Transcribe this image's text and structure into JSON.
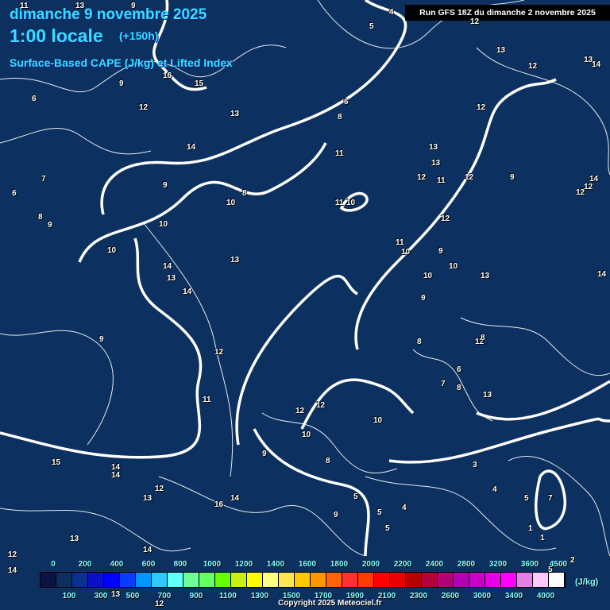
{
  "header": {
    "date": "dimanche 9 novembre 2025",
    "time": "1:00 locale",
    "lead": "(+150h)",
    "parameter": "Surface-Based CAPE (J/kg) et Lifted Index",
    "run": "Run GFS 18Z du dimanche 2 novembre 2025"
  },
  "legend": {
    "unit": "(J/kg)",
    "colors": [
      "#0a1440",
      "#0c2f5e",
      "#0a3090",
      "#0a10c8",
      "#0000ff",
      "#0a3cff",
      "#0096ff",
      "#32c8ff",
      "#64ffff",
      "#6eff96",
      "#64ff64",
      "#64ff00",
      "#c8f014",
      "#ffff00",
      "#ffff80",
      "#ffe650",
      "#ffc800",
      "#ff9600",
      "#ff6400",
      "#ff3232",
      "#ff3c00",
      "#ff0000",
      "#e60000",
      "#b40000",
      "#b4003c",
      "#b40078",
      "#b400b4",
      "#c800c8",
      "#e600e6",
      "#ff00ff",
      "#e680e6",
      "#ffc8ff",
      "#ffffff"
    ],
    "top_labels": [
      "0",
      "200",
      "400",
      "600",
      "800",
      "1000",
      "1200",
      "1400",
      "1600",
      "1800",
      "2000",
      "2200",
      "2400",
      "2800",
      "3200",
      "3600",
      "4500"
    ],
    "bottom_labels": [
      "100",
      "300",
      "500",
      "700",
      "900",
      "1100",
      "1300",
      "1500",
      "1700",
      "1900",
      "2100",
      "2300",
      "2600",
      "3000",
      "3400",
      "4000"
    ]
  },
  "lifted_index_labels": [
    "11",
    "13",
    "9",
    "4",
    "5",
    "12",
    "13",
    "12",
    "13",
    "14",
    "15",
    "16",
    "12",
    "6",
    "9",
    "13",
    "8",
    "6",
    "12",
    "14",
    "13",
    "12",
    "13",
    "11",
    "7",
    "6",
    "8",
    "9",
    "9",
    "8",
    "10",
    "11",
    "10",
    "12",
    "12",
    "11",
    "14",
    "12",
    "9",
    "10",
    "10",
    "13",
    "14",
    "13",
    "9",
    "12",
    "9",
    "10",
    "11",
    "10",
    "13",
    "10",
    "9",
    "8",
    "12",
    "8",
    "6",
    "7",
    "8",
    "13",
    "11",
    "12",
    "12",
    "10",
    "9",
    "8",
    "12",
    "14",
    "15",
    "14",
    "12",
    "13",
    "14",
    "16",
    "14",
    "9",
    "5",
    "5",
    "5",
    "4",
    "3",
    "4",
    "5",
    "7",
    "1",
    "12",
    "13",
    "14",
    "13",
    "14",
    "12",
    "10",
    "14",
    "2",
    "1",
    "5"
  ],
  "copyright": "Copyright 2025 Meteociel.fr"
}
